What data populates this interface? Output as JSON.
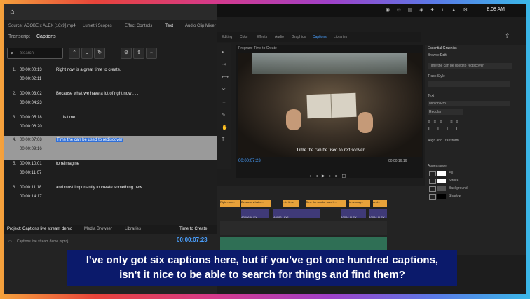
{
  "app": {
    "menubar_clock": "8:08 AM"
  },
  "workspace_tabs": [
    "Editing",
    "Color",
    "Effects",
    "Audio",
    "Graphics",
    "Captions",
    "Libraries"
  ],
  "panel": {
    "source_label": "Source: ADOBE x ALEX [16x9].mp4",
    "panel_tabs": [
      "Lumetri Scopes",
      "Effect Controls",
      "Text",
      "Audio Clip Mixer"
    ],
    "sub_tabs": [
      "Transcript",
      "Captions"
    ],
    "search_placeholder": "Search",
    "search_buttons": [
      "up-arrow",
      "down-arrow",
      "refresh",
      "settings",
      "merge",
      "split"
    ]
  },
  "captions": [
    {
      "num": "1.",
      "in": "00:00:00:13",
      "out": "00:00:02:11",
      "text": "Right now is a great time to create."
    },
    {
      "num": "2.",
      "in": "00:00:03:02",
      "out": "00:00:04:23",
      "text": "Because what we have a lot of right now . . ."
    },
    {
      "num": "3.",
      "in": "00:00:05:18",
      "out": "00:00:06:20",
      "text": ". . . is time"
    },
    {
      "num": "4.",
      "in": "00:00:07:08",
      "out": "00:00:09:16",
      "text": "Time the can be used to rediscover",
      "selected": true
    },
    {
      "num": "5.",
      "in": "00:00:10:01",
      "out": "00:00:11:07",
      "text": "to reimagine"
    },
    {
      "num": "6.",
      "in": "00:00:11:18",
      "out": "00:00:14:17",
      "text": "and most importantly to create something new."
    }
  ],
  "program": {
    "header": "Program: Time to Create",
    "caption_overlay": "Time the can be used to rediscover",
    "timecode": "00:00:07:23",
    "duration": "00:00:16:16"
  },
  "project": {
    "tabs": [
      "Project: Captions live stream demo",
      "Media Browser",
      "Libraries"
    ],
    "item": "Captions live stream demo.prproj",
    "sequence_tab": "Time to Create",
    "sequence_timecode": "00:00:07:23"
  },
  "timeline": {
    "caption_clips": [
      "Right now...",
      "Because what w...",
      "...is time",
      "Time the can be used t...",
      "to reimag...",
      "and..."
    ],
    "video_clips": [
      "A0096 ALEX",
      "A0096 16X1",
      "A0094 ALEX",
      "A0094 ALEX"
    ]
  },
  "essential_graphics": {
    "title": "Essential Graphics",
    "tabs": [
      "Browse",
      "Edit"
    ],
    "text_preview": "Time the can be used to rediscover",
    "sections": [
      "Track Style",
      "Text",
      "Align and Transform",
      "Appearance"
    ],
    "font": "Minion Pro",
    "style": "Regular",
    "appearance_items": [
      "Fill",
      "Stroke",
      "Background",
      "Shadow"
    ]
  },
  "subtitle": {
    "line1": "I've only got six captions here, but if you've got one hundred captions,",
    "line2": "isn't it nice to be able to search for things and find them?"
  },
  "colors": {
    "subtitle_bg": "#0b1a6b",
    "selection": "#2f6fd8",
    "timecode": "#4aa0ff",
    "caption_clip": "#e8a23a"
  }
}
